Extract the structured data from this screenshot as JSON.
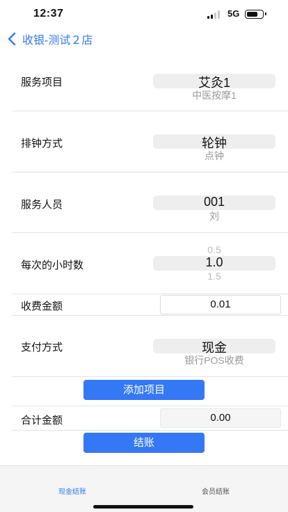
{
  "status_bar": {
    "time": "12:37",
    "network": "5G",
    "battery_level": 0.75
  },
  "nav": {
    "back_icon": "chevron-left-icon",
    "title": "收银-测试２店"
  },
  "form": {
    "service_item": {
      "label": "服务项目",
      "selected": "艾灸1",
      "next": "中医按摩1"
    },
    "scheduling": {
      "label": "排钟方式",
      "selected": "轮钟",
      "next": "点钟"
    },
    "staff": {
      "label": "服务人员",
      "selected": "001",
      "next": "刘"
    },
    "hours": {
      "label": "每次的小时数",
      "prev": "0.5",
      "selected": "1.0",
      "next": "1.5"
    },
    "fee": {
      "label": "收费金额",
      "value": "0.01"
    },
    "payment": {
      "label": "支付方式",
      "selected": "现金",
      "next": "银行POS收费"
    },
    "add_button": "添加项目",
    "total": {
      "label": "合计金额",
      "value": "0.00"
    },
    "checkout_button": "结账"
  },
  "tabbar": {
    "tabs": [
      {
        "label": "现金结账",
        "active": true
      },
      {
        "label": "会员结账",
        "active": false
      }
    ]
  },
  "colors": {
    "accent": "#3478f6",
    "picker_highlight": "#eeeeee",
    "tabbar_bg": "#f5f5f5"
  }
}
